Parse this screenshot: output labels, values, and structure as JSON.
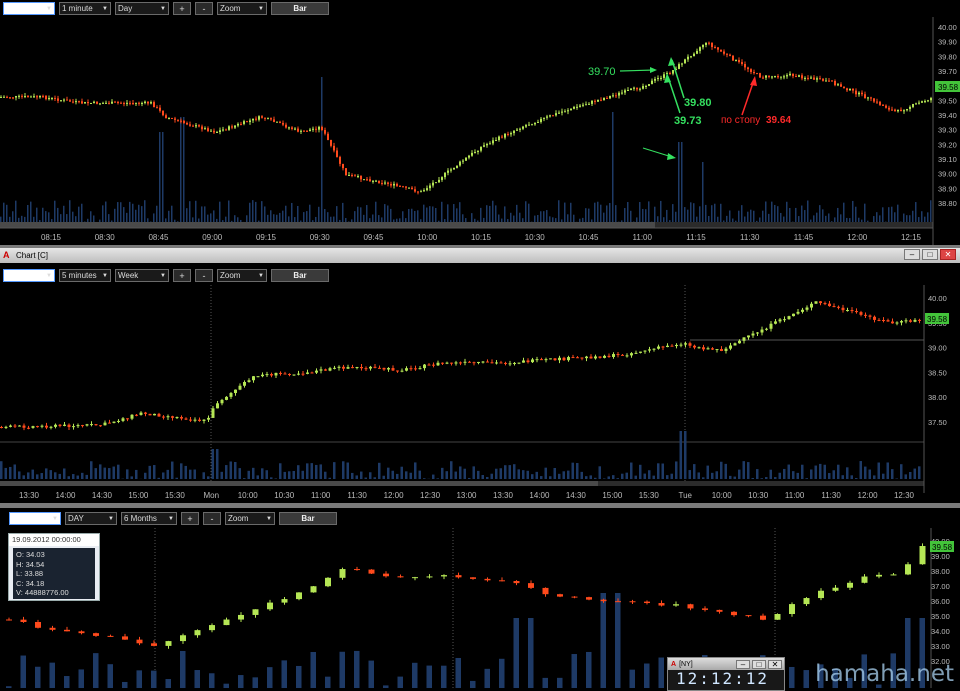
{
  "panel1": {
    "toolbar": {
      "symbol": "",
      "interval": "1 minute",
      "range": "Day",
      "plus": "+",
      "minus": "-",
      "zoom": "Zoom",
      "style": "Bar"
    },
    "price_labels": [
      "40.00",
      "39.90",
      "39.80",
      "39.70",
      "39.60",
      "39.50",
      "39.40",
      "39.30",
      "39.20",
      "39.10",
      "39.00",
      "38.90",
      "38.80"
    ],
    "current_price": "39.58",
    "time_labels": [
      "08:15",
      "08:30",
      "08:45",
      "09:00",
      "09:15",
      "09:30",
      "09:45",
      "10:00",
      "10:15",
      "10:30",
      "10:45",
      "11:00",
      "11:15",
      "11:30",
      "11:45",
      "12:00",
      "12:15"
    ],
    "annotations": {
      "a1": "39.70",
      "a2": "39.80",
      "a3": "39.73",
      "a4_text": "по стопу",
      "a4_value": "39.64"
    },
    "colors": {
      "up": "#b5e655",
      "down": "#ff4a1c",
      "volume": "#1e3a66",
      "ann_green": "#35e060",
      "ann_red": "#ff2a2a",
      "price_tag": "#43c43a"
    }
  },
  "panel2": {
    "window_title": "Chart [C]",
    "toolbar": {
      "symbol": "",
      "interval": "5 minutes",
      "range": "Week",
      "plus": "+",
      "minus": "-",
      "zoom": "Zoom",
      "style": "Bar"
    },
    "price_labels": [
      "40.00",
      "39.50",
      "39.00",
      "38.50",
      "38.00",
      "37.50"
    ],
    "current_price": "39.58",
    "time_labels": [
      "13:30",
      "14:00",
      "14:30",
      "15:00",
      "15:30",
      "Mon",
      "10:00",
      "10:30",
      "11:00",
      "11:30",
      "12:00",
      "12:30",
      "13:00",
      "13:30",
      "14:00",
      "14:30",
      "15:00",
      "15:30",
      "Tue",
      "10:00",
      "10:30",
      "11:00",
      "11:30",
      "12:00",
      "12:30"
    ]
  },
  "panel3": {
    "toolbar": {
      "symbol": "",
      "interval": "DAY",
      "range": "6 Months",
      "plus": "+",
      "minus": "-",
      "zoom": "Zoom",
      "style": "Bar"
    },
    "price_labels": [
      "40.00",
      "39.00",
      "38.00",
      "37.00",
      "36.00",
      "35.00",
      "34.00",
      "33.00",
      "32.00"
    ],
    "current_price": "39.58",
    "info": {
      "date": "19.09.2012 00:00:00",
      "o": "O: 34.03",
      "h": "H: 34.54",
      "l": "L: 33.88",
      "c": "C: 34.18",
      "v": "V: 44888776.00"
    },
    "clock_title": "[NY]",
    "clock_time": "12:12:12"
  },
  "watermark": "hamaha.net"
}
